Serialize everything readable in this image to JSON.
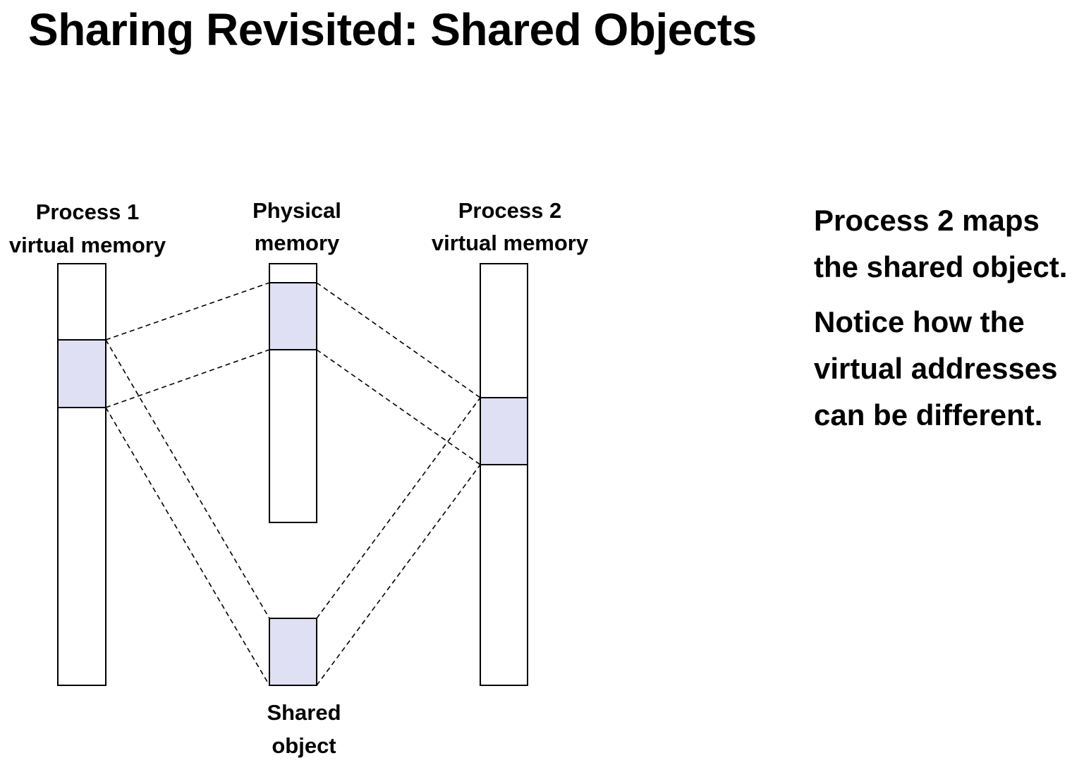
{
  "slide": {
    "title": "Sharing Revisited: Shared Objects"
  },
  "diagram": {
    "process1_label_line1": "Process 1",
    "process1_label_line2": "virtual memory",
    "physical_label_line1": "Physical",
    "physical_label_line2": "memory",
    "process2_label_line1": "Process 2",
    "process2_label_line2": "virtual memory",
    "shared_label_line1": "Shared",
    "shared_label_line2": "object",
    "colors": {
      "shared_fill": "#dfe0f3",
      "stroke": "#000000",
      "background": "#ffffff"
    }
  },
  "notes": {
    "paragraph1": "Process 2 maps the shared object.",
    "paragraph2": "Notice how the virtual addresses can be different."
  }
}
